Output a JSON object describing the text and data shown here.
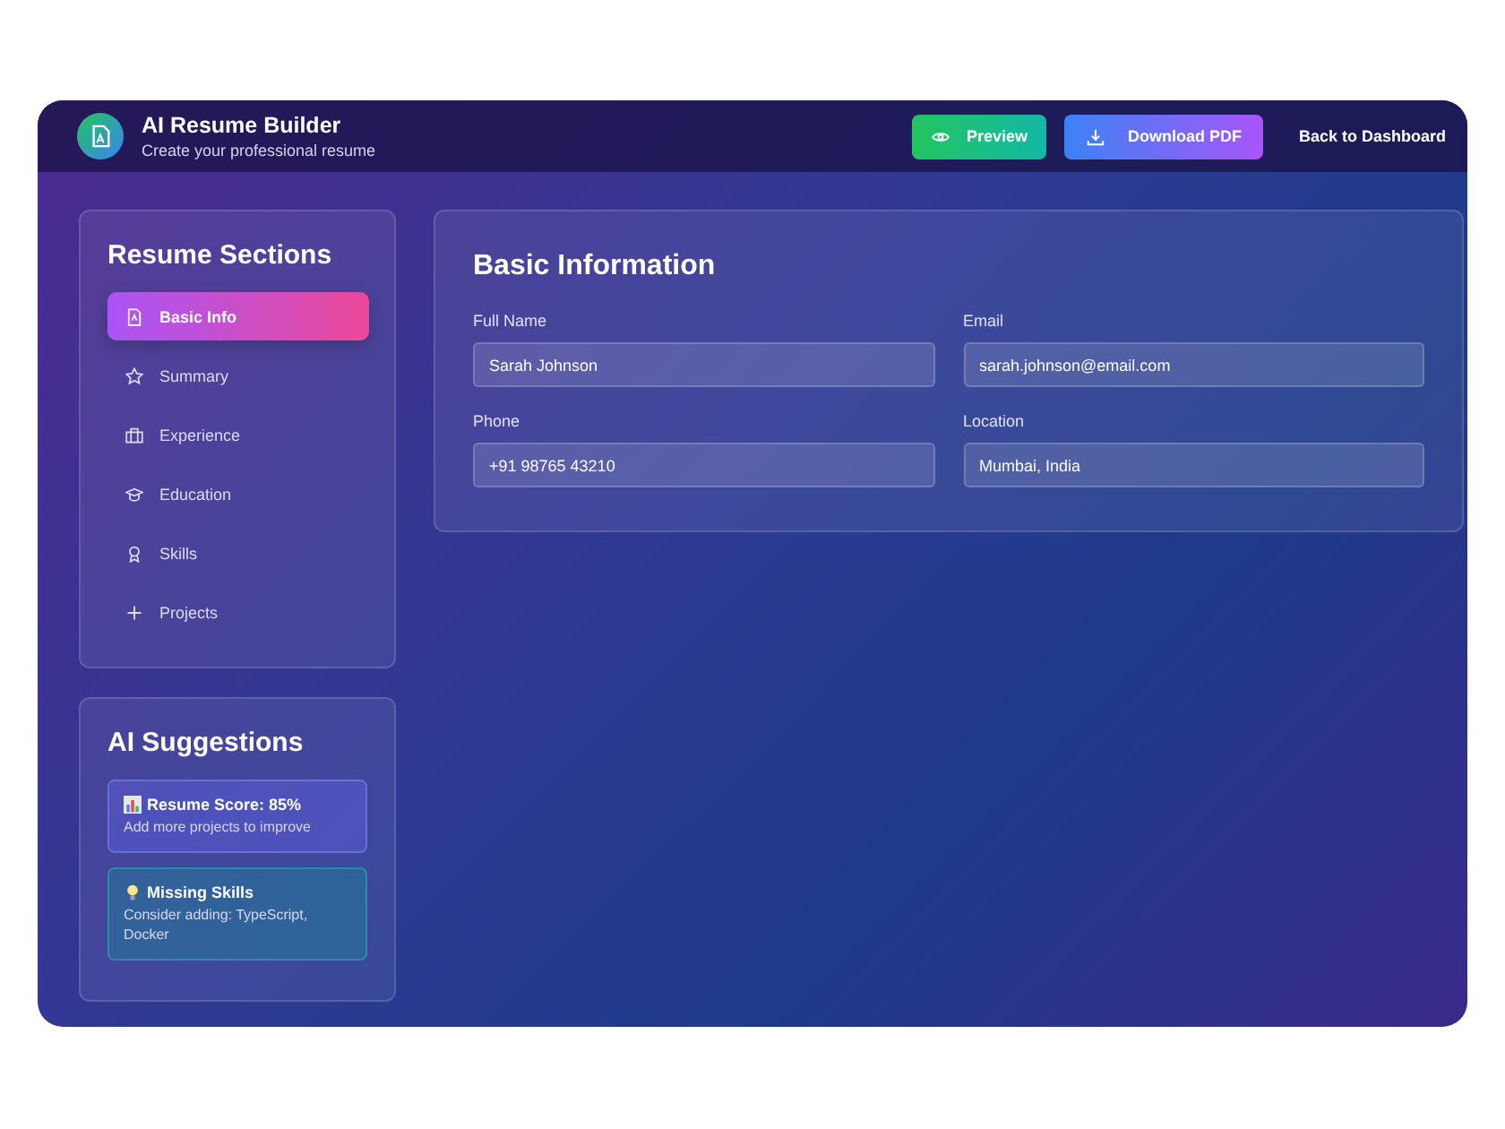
{
  "header": {
    "title": "AI Resume Builder",
    "subtitle": "Create your professional resume",
    "buttons": [
      {
        "label": "Preview",
        "kind": "preview"
      },
      {
        "label": "Download PDF",
        "kind": "download"
      },
      {
        "label": "Back to Dashboard",
        "kind": "link"
      }
    ]
  },
  "sections": {
    "title": "Resume Sections",
    "items": [
      {
        "label": "Basic Info",
        "selected": true
      },
      {
        "label": "Summary",
        "selected": false
      },
      {
        "label": "Experience",
        "selected": false
      },
      {
        "label": "Education",
        "selected": false
      },
      {
        "label": "Skills",
        "selected": false
      },
      {
        "label": "Projects",
        "selected": false
      }
    ]
  },
  "suggestions": {
    "title": "AI Suggestions",
    "items": [
      {
        "kind": "score",
        "title": "Resume Score: 85%",
        "text": "Add more projects to improve"
      },
      {
        "kind": "tip",
        "title": "Missing Skills",
        "text": "Consider adding: TypeScript, Docker"
      }
    ]
  },
  "form": {
    "title": "Basic Information",
    "fields": [
      {
        "label": "Full Name",
        "value": "Sarah Johnson"
      },
      {
        "label": "Email",
        "value": "sarah.johnson@email.com"
      },
      {
        "label": "Phone",
        "value": "+91 98765 43210"
      },
      {
        "label": "Location",
        "value": "Mumbai, India"
      }
    ]
  }
}
